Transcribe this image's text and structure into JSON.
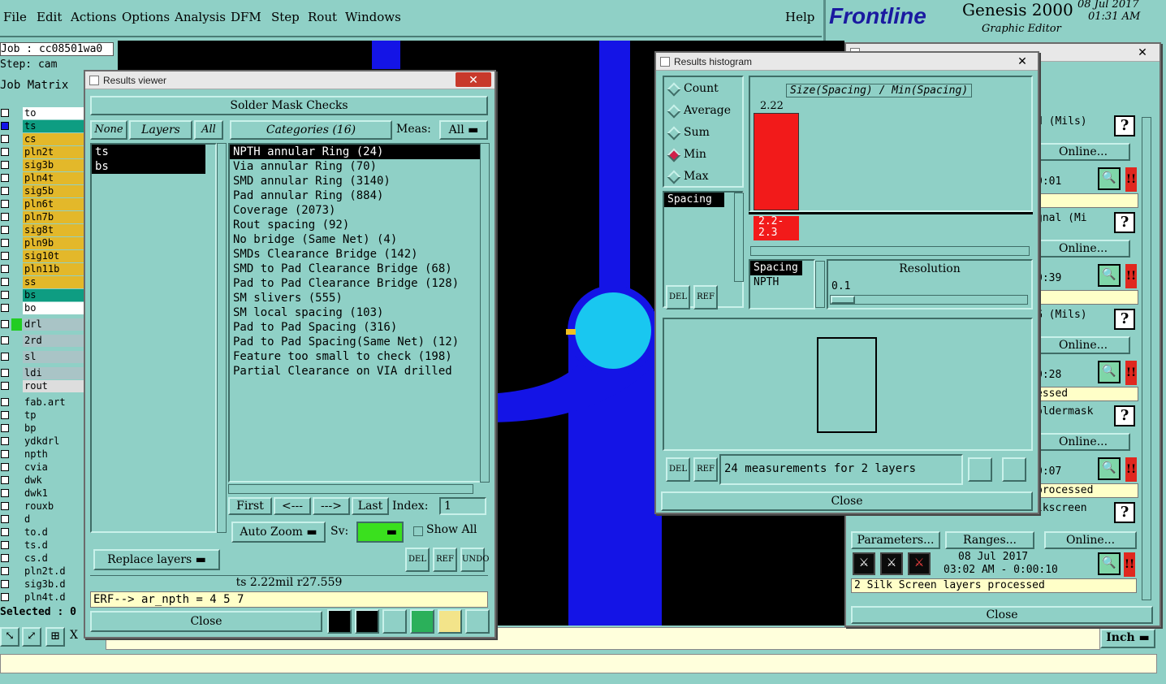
{
  "menu": {
    "items": [
      "File",
      "Edit",
      "Actions",
      "Options",
      "Analysis",
      "DFM",
      "Step",
      "Rout",
      "Windows"
    ],
    "help": "Help"
  },
  "logo": {
    "brand": "Frontline",
    "product": "Genesis 2000",
    "subtitle": "Graphic Editor",
    "date": "08 Jul 2017",
    "time": "01:31 AM"
  },
  "left_panel": {
    "job": "Job : cc08501wa0",
    "step": "Step: cam",
    "matrix_title": "Job Matrix",
    "layers": [
      {
        "name": "to",
        "color": "#ffffff",
        "box": "#ffffff"
      },
      {
        "name": "ts",
        "color": "#0e9d82",
        "box": "#1414e6"
      },
      {
        "name": "cs",
        "color": "#e3b82a",
        "box": "#ffffff"
      },
      {
        "name": "pln2t",
        "color": "#e3b82a",
        "box": "#ffffff"
      },
      {
        "name": "sig3b",
        "color": "#e3b82a",
        "box": "#ffffff"
      },
      {
        "name": "pln4t",
        "color": "#e3b82a",
        "box": "#ffffff"
      },
      {
        "name": "sig5b",
        "color": "#e3b82a",
        "box": "#ffffff"
      },
      {
        "name": "pln6t",
        "color": "#e3b82a",
        "box": "#ffffff"
      },
      {
        "name": "pln7b",
        "color": "#e3b82a",
        "box": "#ffffff"
      },
      {
        "name": "sig8t",
        "color": "#e3b82a",
        "box": "#ffffff"
      },
      {
        "name": "pln9b",
        "color": "#e3b82a",
        "box": "#ffffff"
      },
      {
        "name": "sig10t",
        "color": "#e3b82a",
        "box": "#ffffff"
      },
      {
        "name": "pln11b",
        "color": "#e3b82a",
        "box": "#ffffff"
      },
      {
        "name": "ss",
        "color": "#e3b82a",
        "box": "#ffffff"
      },
      {
        "name": "bs",
        "color": "#0e9d82",
        "box": "#ffffff"
      },
      {
        "name": "bo",
        "color": "#ffffff",
        "box": "#ffffff"
      },
      {
        "name": "drl",
        "color": "#a9c4c6",
        "box": "#ffffff",
        "mark": "#22cc22"
      },
      {
        "name": "2rd",
        "color": "#a9c4c6",
        "box": "#ffffff"
      },
      {
        "name": "sl",
        "color": "#a9c4c6",
        "box": "#ffffff"
      },
      {
        "name": "ldi",
        "color": "#a9c4c6",
        "box": "#ffffff"
      },
      {
        "name": "rout",
        "color": "#dddddd",
        "box": "#ffffff"
      },
      {
        "name": "fab.art",
        "color": "#8fd0c6",
        "box": "#ffffff"
      },
      {
        "name": "tp",
        "color": "#8fd0c6",
        "box": "#ffffff"
      },
      {
        "name": "bp",
        "color": "#8fd0c6",
        "box": "#ffffff"
      },
      {
        "name": "ydkdrl",
        "color": "#8fd0c6",
        "box": "#ffffff"
      },
      {
        "name": "npth",
        "color": "#8fd0c6",
        "box": "#ffffff"
      },
      {
        "name": "cvia",
        "color": "#8fd0c6",
        "box": "#ffffff"
      },
      {
        "name": "dwk",
        "color": "#8fd0c6",
        "box": "#ffffff"
      },
      {
        "name": "dwk1",
        "color": "#8fd0c6",
        "box": "#ffffff"
      },
      {
        "name": "rouxb",
        "color": "#8fd0c6",
        "box": "#ffffff"
      },
      {
        "name": "d",
        "color": "#8fd0c6",
        "box": "#ffffff"
      },
      {
        "name": "to.d",
        "color": "#8fd0c6",
        "box": "#ffffff"
      },
      {
        "name": "ts.d",
        "color": "#8fd0c6",
        "box": "#ffffff"
      },
      {
        "name": "cs.d",
        "color": "#8fd0c6",
        "box": "#ffffff"
      },
      {
        "name": "pln2t.d",
        "color": "#8fd0c6",
        "box": "#ffffff"
      },
      {
        "name": "sig3b.d",
        "color": "#8fd0c6",
        "box": "#ffffff"
      },
      {
        "name": "pln4t.d",
        "color": "#8fd0c6",
        "box": "#ffffff"
      }
    ],
    "selected": "Selected : 0",
    "x_label": "X"
  },
  "results_viewer": {
    "title": "Results viewer",
    "close_x": "✕",
    "header": "Solder Mask Checks",
    "none_btn": "None",
    "layers_btn": "Layers",
    "all_btn": "All",
    "layers": [
      "ts",
      "bs"
    ],
    "categories_label": "Categories (16)",
    "meas_label": "Meas:",
    "meas_value": "All",
    "categories": [
      "NPTH annular Ring (24)",
      "Via annular Ring (70)",
      "SMD annular Ring (3140)",
      "Pad annular Ring (884)",
      "Coverage (2073)",
      "Rout spacing (92)",
      "No bridge (Same Net) (4)",
      "SMDs Clearance Bridge (142)",
      "SMD to Pad Clearance Bridge (68)",
      "Pad to Pad Clearance Bridge (128)",
      "SM slivers (555)",
      "SM local spacing (103)",
      "Pad to Pad Spacing (316)",
      "Pad to Pad Spacing(Same Net) (12)",
      "Feature too small to check (198)",
      "Partial Clearance on VIA drilled"
    ],
    "first": "First",
    "prev": "<---",
    "next": "--->",
    "last": "Last",
    "index_label": "Index:",
    "index_value": "1",
    "auto_zoom": "Auto Zoom",
    "sv": "Sv:",
    "show_all": "Show All",
    "replace_layers": "Replace layers",
    "del": "DEL",
    "ref": "REF",
    "undo": "UNDO",
    "status": "ts 2.22mil  r27.559",
    "erf": "ERF--> ar_npth = 4 5 7",
    "close": "Close"
  },
  "histogram": {
    "title": "Results histogram",
    "close_x": "✕",
    "modes": [
      "Count",
      "Average",
      "Sum",
      "Min",
      "Max"
    ],
    "selected_mode": "Min",
    "chart_title": "Size(Spacing) / Min(Spacing)",
    "bar_label": "2.22",
    "range_label": "2.2-\n2.3",
    "list1": [
      "Spacing"
    ],
    "list2": [
      "Spacing",
      "NPTH"
    ],
    "resolution_label": "Resolution",
    "resolution_value": "0.1",
    "measurements": "24 measurements for 2 layers",
    "close": "Close",
    "del": "DEL",
    "ref": "REF"
  },
  "checklist": {
    "rows": [
      {
        "label": "d (Mils)",
        "time": "0:01",
        "status": ""
      },
      {
        "label": "gnal (Mi",
        "time": "0:39",
        "status": ""
      },
      {
        "label": "G (Mils)",
        "time": "0:28",
        "status": "essed"
      },
      {
        "label": "oldermask",
        "time": "0:07",
        "status": "processed"
      },
      {
        "label": "lkscreen",
        "time": "",
        "status": ""
      }
    ],
    "online": "Online...",
    "parameters": "Parameters...",
    "ranges": "Ranges...",
    "date": "08 Jul 2017",
    "time_range": "03:02 AM - 0:00:10",
    "status_text": "2 Silk Screen layers processed",
    "close": "Close",
    "close_x": "✕",
    "q": "?",
    "flag": "!!"
  },
  "bottom": {
    "unit": "Inch"
  }
}
